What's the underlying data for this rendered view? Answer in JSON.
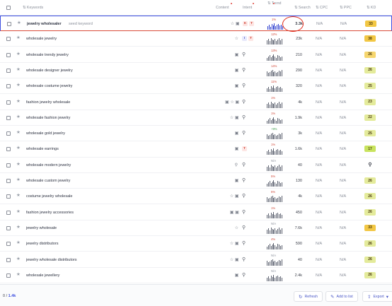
{
  "header": {
    "keyword": "Keywords",
    "serp_features": "Content",
    "intent": "Intent",
    "trend": "Trend",
    "search": "Search",
    "cpc": "CPC",
    "ppc": "PPC",
    "kd": "KD"
  },
  "rows": [
    {
      "keyword": "jewelry wholesaler",
      "seed": "seed keyword",
      "features": "☆ ▣",
      "intent": [
        "K",
        "T"
      ],
      "trend_pct": "1%",
      "volume": "3.3k",
      "cpc": "N/A",
      "ppc": "N/A",
      "kd": "33",
      "kd_color": "#f2c744",
      "bold": true
    },
    {
      "keyword": "wholesale jewelry",
      "features": "☆",
      "intent": [
        "I",
        "T"
      ],
      "trend_pct": "12%",
      "volume": "23k",
      "cpc": "N/A",
      "ppc": "N/A",
      "kd": "38",
      "kd_color": "#f2c744"
    },
    {
      "keyword": "wholesale trendy jewelry",
      "features": "▣",
      "intent": [
        "Q"
      ],
      "trend_pct": "13%",
      "volume": "210",
      "cpc": "N/A",
      "ppc": "N/A",
      "kd": "26",
      "kd_color": "#f6d66e"
    },
    {
      "keyword": "wholesale designer jewelry",
      "features": "▣",
      "intent": [
        "Q"
      ],
      "trend_pct": "14%",
      "volume": "290",
      "cpc": "N/A",
      "ppc": "N/A",
      "kd": "26",
      "kd_color": "#e4eb9b"
    },
    {
      "keyword": "wholesale costume jewelry",
      "features": "▣",
      "intent": [
        "Q"
      ],
      "trend_pct": "11%",
      "volume": "320",
      "cpc": "N/A",
      "ppc": "N/A",
      "kd": "25",
      "kd_color": "#e4eb9b"
    },
    {
      "keyword": "fashion jewelry wholesale",
      "features": "▣ ☆ ▣",
      "intent": [
        "Q"
      ],
      "trend_pct": "1%",
      "volume": "4k",
      "cpc": "N/A",
      "ppc": "N/A",
      "kd": "23",
      "kd_color": "#e4eb9b"
    },
    {
      "keyword": "wholesale fashion jewelry",
      "features": "☆ ▣",
      "intent": [
        "Q"
      ],
      "trend_pct": "1%",
      "volume": "1.9k",
      "cpc": "N/A",
      "ppc": "N/A",
      "kd": "22",
      "kd_color": "#e4eb9b"
    },
    {
      "keyword": "wholesale gold jewelry",
      "features": "▣",
      "intent": [
        "Q"
      ],
      "trend_pct": "+9%",
      "up": true,
      "volume": "3k",
      "cpc": "N/A",
      "ppc": "N/A",
      "kd": "25",
      "kd_color": "#e4eb9b"
    },
    {
      "keyword": "wholesale earrings",
      "features": "▣",
      "intent": [
        "T"
      ],
      "trend_pct": "1%",
      "volume": "1.6k",
      "cpc": "N/A",
      "ppc": "N/A",
      "kd": "17",
      "kd_color": "#c8e35e"
    },
    {
      "keyword": "wholesale modern jewelry",
      "features": "Q",
      "intent": [
        "Q"
      ],
      "trend_pct": "N/A",
      "na": true,
      "volume": "40",
      "cpc": "N/A",
      "ppc": "N/A",
      "kd": "Q",
      "kd_color": "#ffffff"
    },
    {
      "keyword": "wholesale custom jewelry",
      "features": "▣",
      "intent": [
        "Q"
      ],
      "trend_pct": "5%",
      "volume": "130",
      "cpc": "N/A",
      "ppc": "N/A",
      "kd": "26",
      "kd_color": "#e4eb9b"
    },
    {
      "keyword": "costume jewelry wholesale",
      "features": "☆ ▣",
      "intent": [
        "Q"
      ],
      "trend_pct": "5%",
      "volume": "4k",
      "cpc": "N/A",
      "ppc": "N/A",
      "kd": "26",
      "kd_color": "#e4eb9b"
    },
    {
      "keyword": "fashion jewelry accessories",
      "features": "▣ ▣",
      "intent": [
        "Q"
      ],
      "trend_pct": "1%",
      "volume": "450",
      "cpc": "N/A",
      "ppc": "N/A",
      "kd": "26",
      "kd_color": "#e4eb9b"
    },
    {
      "keyword": "jewelry wholesale",
      "features": "☆",
      "intent": [
        "Q"
      ],
      "trend_pct": "N/A",
      "na": true,
      "volume": "7.6k",
      "cpc": "N/A",
      "ppc": "N/A",
      "kd": "33",
      "kd_color": "#f2c744"
    },
    {
      "keyword": "jewelry distributors",
      "features": "☆ ▣",
      "intent": [
        "Q"
      ],
      "trend_pct": "4%",
      "volume": "590",
      "cpc": "N/A",
      "ppc": "N/A",
      "kd": "26",
      "kd_color": "#e4eb9b"
    },
    {
      "keyword": "jewelry wholesale distributors",
      "features": "☆ ▣",
      "intent": [
        "Q"
      ],
      "trend_pct": "N/A",
      "na": true,
      "volume": "40",
      "cpc": "N/A",
      "ppc": "N/A",
      "kd": "26",
      "kd_color": "#e4eb9b"
    },
    {
      "keyword": "wholesale jewellery",
      "features": "▣",
      "intent": [
        "Q"
      ],
      "trend_pct": "N/A",
      "na": true,
      "volume": "2.4k",
      "cpc": "N/A",
      "ppc": "N/A",
      "kd": "26",
      "kd_color": "#e4eb9b"
    }
  ],
  "footer": {
    "count": "1.4k",
    "refresh": "Refresh",
    "add_to_list": "Add to list",
    "export": "Export"
  },
  "colors": {
    "accent": "#3d4fe0",
    "annotation": "#e02a1a"
  }
}
